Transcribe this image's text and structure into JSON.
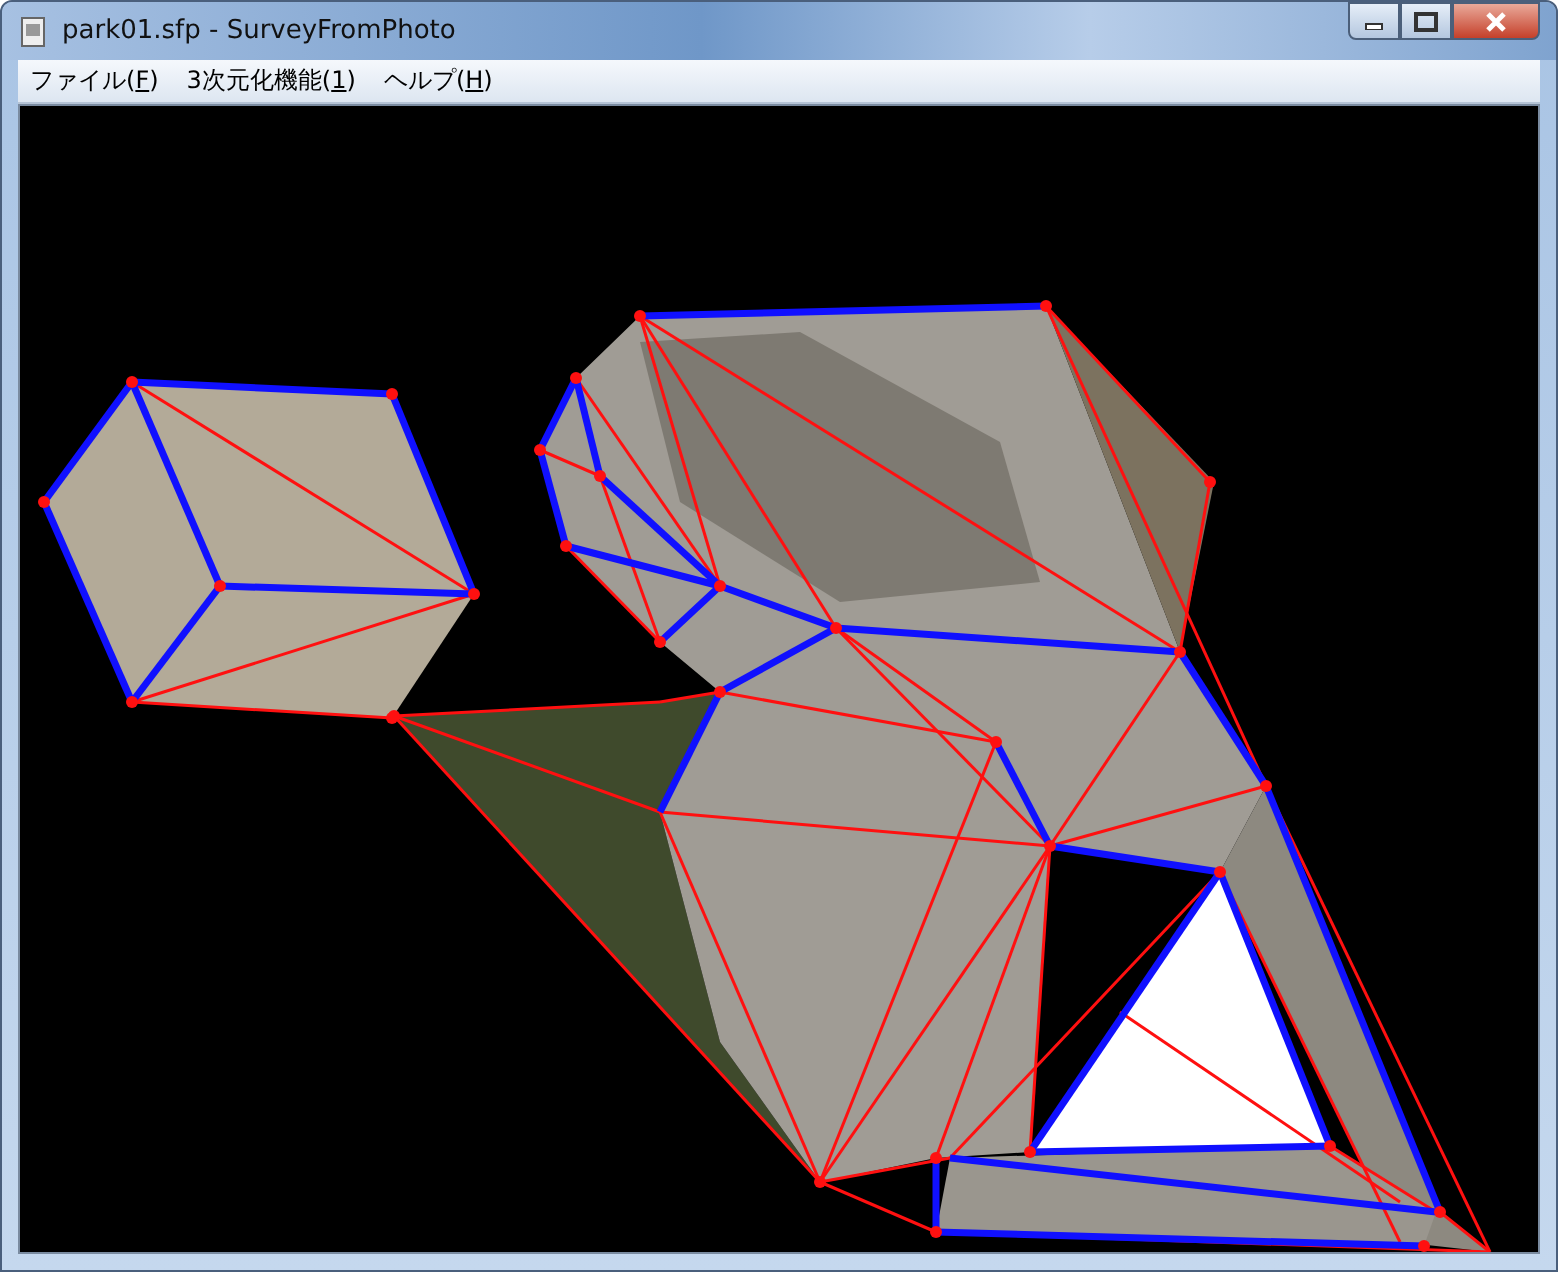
{
  "window": {
    "title": "park01.sfp - SurveyFromPhoto"
  },
  "menu": [
    {
      "label": "ファイル(F)"
    },
    {
      "label": "3次元化機能(1)"
    },
    {
      "label": "ヘルプ(H)"
    }
  ]
}
